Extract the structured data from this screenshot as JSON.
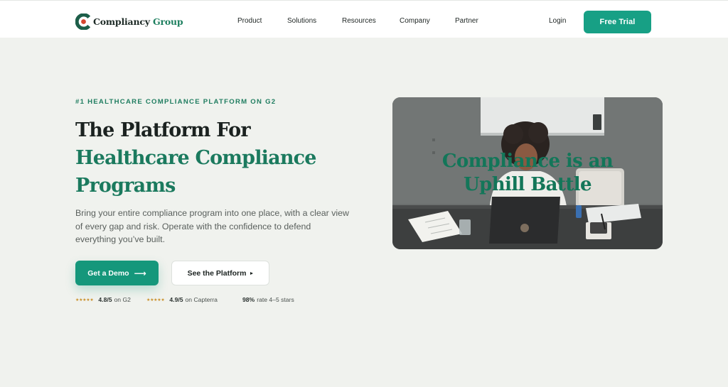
{
  "nav": {
    "logo": {
      "word1": "Compliancy",
      "word2": "Group"
    },
    "links": [
      "Product",
      "Solutions",
      "Resources",
      "Company",
      "Partner"
    ],
    "login": "Login",
    "cta": "Free Trial"
  },
  "hero": {
    "eyebrow": "#1 HEALTHCARE COMPLIANCE PLATFORM ON G2",
    "headline": {
      "line1": "The Platform For",
      "line2": "Healthcare Compliance",
      "line3": "Programs"
    },
    "subcopy": "Bring your entire compliance program into one place, with a clear view of every gap and risk. Operate with the confidence to defend everything you’ve built.",
    "primary_button": "Get a Demo",
    "secondary_button": "See the Platform",
    "ratings": [
      {
        "stars": "★★★★★",
        "score": "4.8/5",
        "source": "on G2"
      },
      {
        "stars": "★★★★★",
        "score": "4.9/5",
        "source": "on Capterra"
      },
      {
        "stars": "",
        "score": "98%",
        "source": "rate 4–5 stars"
      }
    ],
    "media": {
      "title_line1": "Compliance is an",
      "title_line2": "Uphill Battle"
    }
  },
  "colors": {
    "brand_green": "#17a085",
    "headline_green": "#1b7a5e",
    "page_background": "#f0f2ee",
    "star_gold": "#c9902a"
  }
}
